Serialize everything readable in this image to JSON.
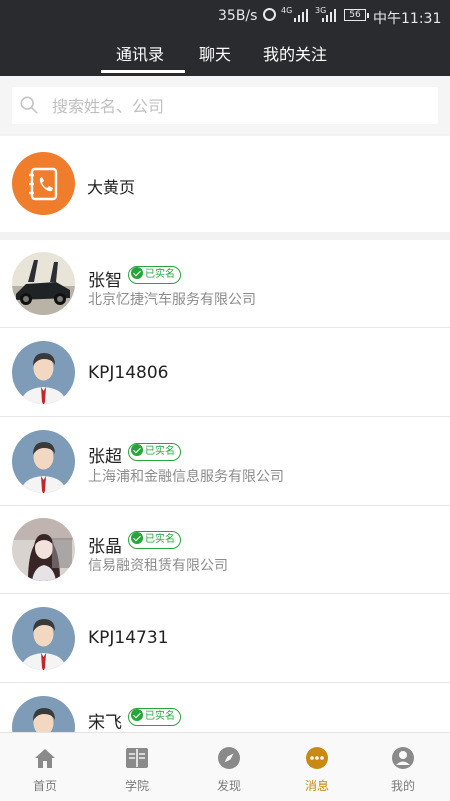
{
  "status_bar": {
    "net_speed": "35B/s",
    "network": "4G",
    "network_sub": "3G",
    "battery": "56",
    "time": "中午11:31"
  },
  "tabs": [
    {
      "label": "通讯录",
      "active": true
    },
    {
      "label": "聊天",
      "active": false
    },
    {
      "label": "我的关注",
      "active": false
    }
  ],
  "search": {
    "placeholder": "搜索姓名、公司",
    "value": ""
  },
  "yellow_pages": {
    "label": "大黄页",
    "icon": "phone-book-icon",
    "color": "#f07d2c"
  },
  "verified_label": "已实名",
  "contacts": [
    {
      "name": "张智",
      "verified": true,
      "company": "北京忆捷汽车服务有限公司",
      "avatar": "car-photo"
    },
    {
      "name": "KPJ14806",
      "verified": false,
      "company": "",
      "avatar": "default-man"
    },
    {
      "name": "张超",
      "verified": true,
      "company": "上海浦和金融信息服务有限公司",
      "avatar": "default-man"
    },
    {
      "name": "张晶",
      "verified": true,
      "company": "信易融资租赁有限公司",
      "avatar": "anime-girl"
    },
    {
      "name": "KPJ14731",
      "verified": false,
      "company": "",
      "avatar": "default-man"
    },
    {
      "name": "宋飞",
      "verified": true,
      "company": "",
      "avatar": "default-man"
    }
  ],
  "bottom_nav": [
    {
      "label": "首页",
      "icon": "home-icon",
      "active": false
    },
    {
      "label": "学院",
      "icon": "book-icon",
      "active": false
    },
    {
      "label": "发现",
      "icon": "compass-icon",
      "active": false
    },
    {
      "label": "消息",
      "icon": "message-icon",
      "active": true
    },
    {
      "label": "我的",
      "icon": "profile-icon",
      "active": false
    }
  ],
  "colors": {
    "header_bg": "#2a2b2f",
    "accent_orange": "#f07d2c",
    "verified_green": "#27a53b",
    "nav_active": "#c88a12"
  }
}
